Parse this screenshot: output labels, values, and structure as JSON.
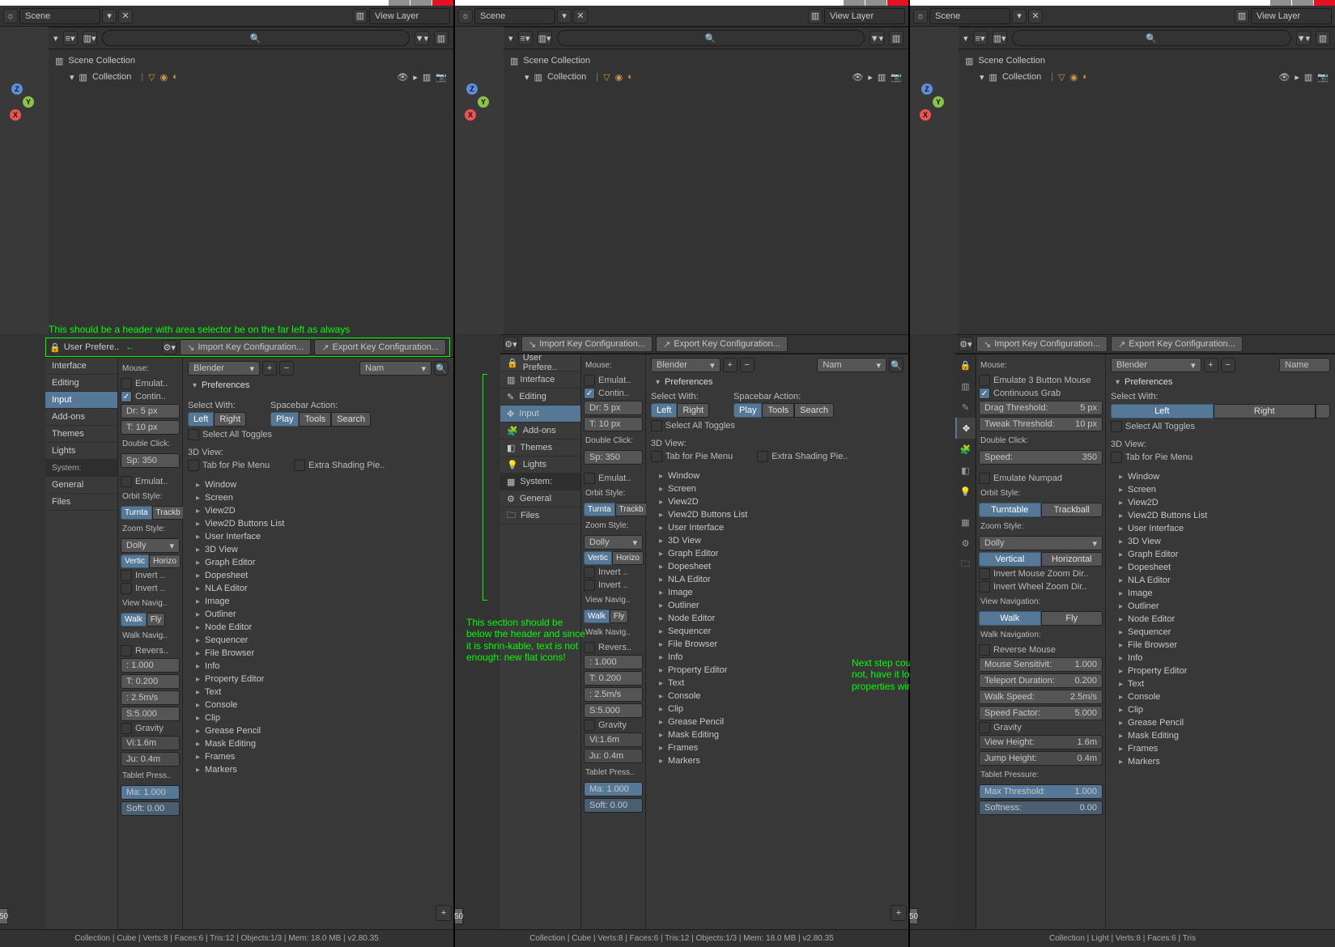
{
  "topbar": {
    "scene": "Scene",
    "viewlayer": "View Layer"
  },
  "outliner": {
    "root": "Scene Collection",
    "coll": "Collection"
  },
  "annot": {
    "a1": "This should be a header with area selector be on the far left as always",
    "a2": "This section should be below the header and since it is shrin-kable, text is not enough: new flat icons!",
    "a3": "Next step could be, why not, have it look like the properties window tabs"
  },
  "pref_hdr": {
    "user": "User Prefere..",
    "user2": "User Prefere..",
    "imp": "Import Key Configuration...",
    "exp": "Export Key Configuration..."
  },
  "tabs": [
    "Interface",
    "Editing",
    "Input",
    "Add-ons",
    "Themes",
    "Lights"
  ],
  "tabs_sys_head": "System:",
  "tabs_sys": [
    "General",
    "Files"
  ],
  "mouse": {
    "head": "Mouse:",
    "emulate": "Emulat..",
    "emulate_full": "Emulate 3 Button Mouse",
    "contin": "Contin..",
    "contin_full": "Continuous Grab",
    "drag": "Dr: 5 px",
    "drag_full_l": "Drag Threshold:",
    "drag_full_r": "5 px",
    "tweak": "T: 10 px",
    "tweak_full_l": "Tweak Threshold:",
    "tweak_full_r": "10 px",
    "dbl": "Double Click:",
    "speed": "Sp: 350",
    "speed_full_l": "Speed:",
    "speed_full_r": "350",
    "emul2": "Emulat..",
    "emul2_full": "Emulate Numpad",
    "orbit": "Orbit Style:",
    "turn": "Turnta",
    "track": "Trackb",
    "turn_full": "Turntable",
    "track_full": "Trackball",
    "zoom": "Zoom Style:",
    "dolly": "Dolly",
    "vert": "Vertic",
    "horiz": "Horizo",
    "vert_full": "Vertical",
    "horiz_full": "Horizontal",
    "inv1": "Invert ..",
    "inv1_full": "Invert Mouse Zoom Dir..",
    "inv2": "Invert ..",
    "inv2_full": "Invert Wheel Zoom Dir..",
    "vnav": "View Navig..",
    "vnav_full": "View Navigation:",
    "walk": "Walk",
    "fly": "Fly",
    "wnav": "Walk Navig..",
    "wnav_full": "Walk Navigation:",
    "revers": "Revers..",
    "revers_full": "Reverse Mouse",
    "msens": ": 1.000",
    "msens_l": "Mouse Sensitivit:",
    "msens_r": "1.000",
    "tele": "T: 0.200",
    "tele_l": "Teleport Duration:",
    "tele_r": "0.200",
    "wspd": ": 2.5m/s",
    "wspd_l": "Walk Speed:",
    "wspd_r": "2.5m/s",
    "sfac": "S:5.000",
    "sfac_l": "Speed Factor:",
    "sfac_r": "5.000",
    "grav": "Gravity",
    "vh": "Vi:1.6m",
    "vh_l": "View Height:",
    "vh_r": "1.6m",
    "jh": "Ju: 0.4m",
    "jh_l": "Jump Height:",
    "jh_r": "0.4m",
    "tpress": "Tablet Press..",
    "tpress_full": "Tablet Pressure:",
    "max": "Ma: 1.000",
    "max_l": "Max Threshold:",
    "max_r": "1.000",
    "soft": "Soft: 0.00",
    "soft_l": "Softness:",
    "soft_r": "0.00"
  },
  "right": {
    "preset": "Blender",
    "name": "Nam",
    "name_full": "Name",
    "prefs": "Preferences",
    "selectwith": "Select With:",
    "left": "Left",
    "right": "Right",
    "spacebar": "Spacebar Action:",
    "play": "Play",
    "tool": "Tools",
    "search": "Search",
    "selall": "Select All Toggles",
    "view3d": "3D View:",
    "tabpie": "Tab for Pie Menu",
    "extrashade": "Extra Shading Pie..",
    "tree": [
      "Window",
      "Screen",
      "View2D",
      "View2D Buttons List",
      "User Interface",
      "3D View",
      "Graph Editor",
      "Dopesheet",
      "NLA Editor",
      "Image",
      "Outliner",
      "Node Editor",
      "Sequencer",
      "File Browser",
      "Info",
      "Property Editor",
      "Text",
      "Console",
      "Clip",
      "Grease Pencil",
      "Mask Editing",
      "Frames",
      "Markers"
    ]
  },
  "status": {
    "s1": "Collection | Cube | Verts:8 | Faces:6 | Tris:12 | Objects:1/3 | Mem: 18.0 MB | v2.80.35",
    "s3": "Collection | Light | Verts:8 | Faces:6 | Tris"
  },
  "fifty": "50"
}
